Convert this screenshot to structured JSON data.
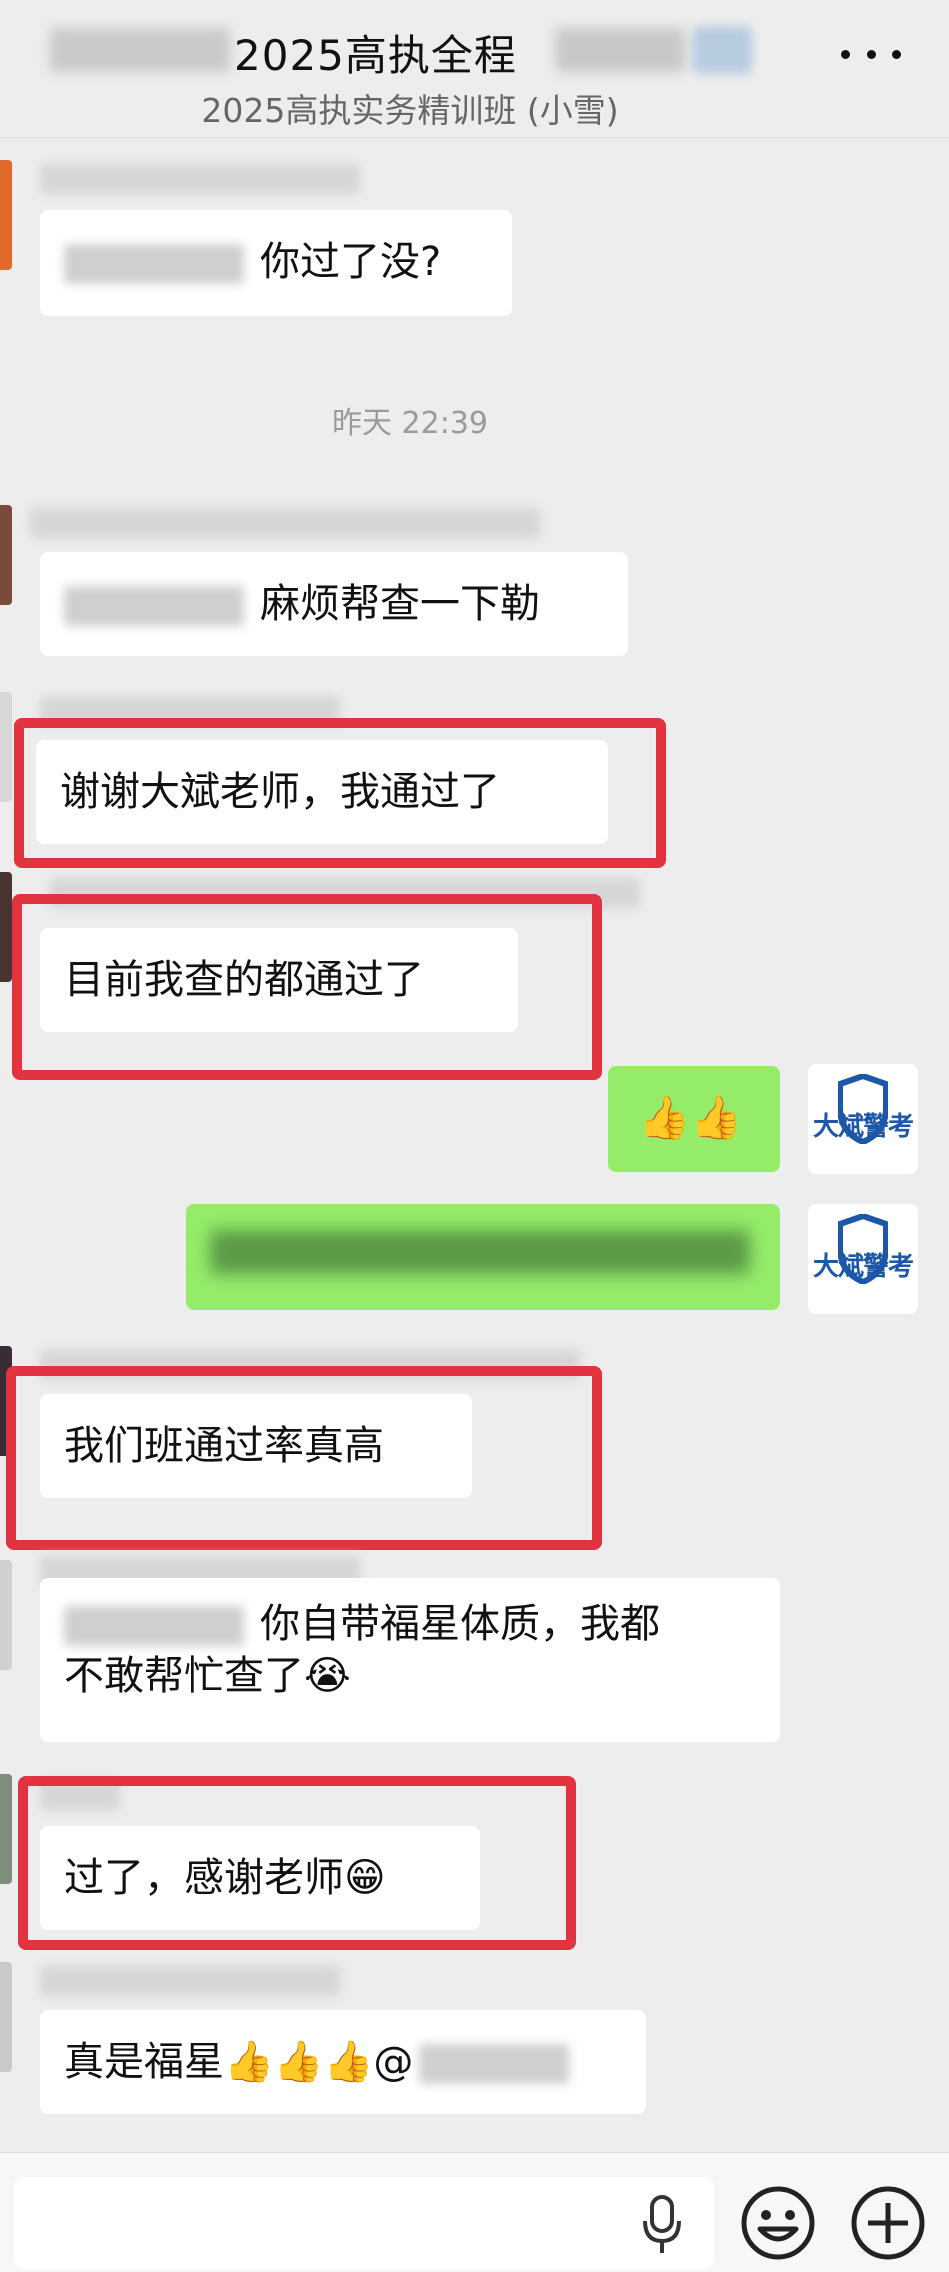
{
  "header": {
    "title": "2025高执全程",
    "subtitle": "2025高执实务精训班 (小雪)"
  },
  "messages": {
    "m1": "你过了没?",
    "timestamp": "昨天 22:39",
    "m2": "麻烦帮查一下勒",
    "m3": "谢谢大斌老师，我通过了",
    "m4": "目前我查的都通过了",
    "m5_emoji": "👍👍",
    "m7": "我们班通过率真高",
    "m8_line1": "你自带福星体质，我都",
    "m8_line2": "不敢帮忙查了😭",
    "m9": "过了，感谢老师😁",
    "m10": "真是福星👍👍👍@"
  },
  "avatar_logo": "大斌警考",
  "colors": {
    "background": "#ededed",
    "self_bubble": "#95ec69",
    "highlight_box": "#e33340"
  },
  "icons": {
    "more": "more-icon",
    "mic": "mic-icon",
    "emoji": "emoji-icon",
    "plus": "plus-icon"
  }
}
